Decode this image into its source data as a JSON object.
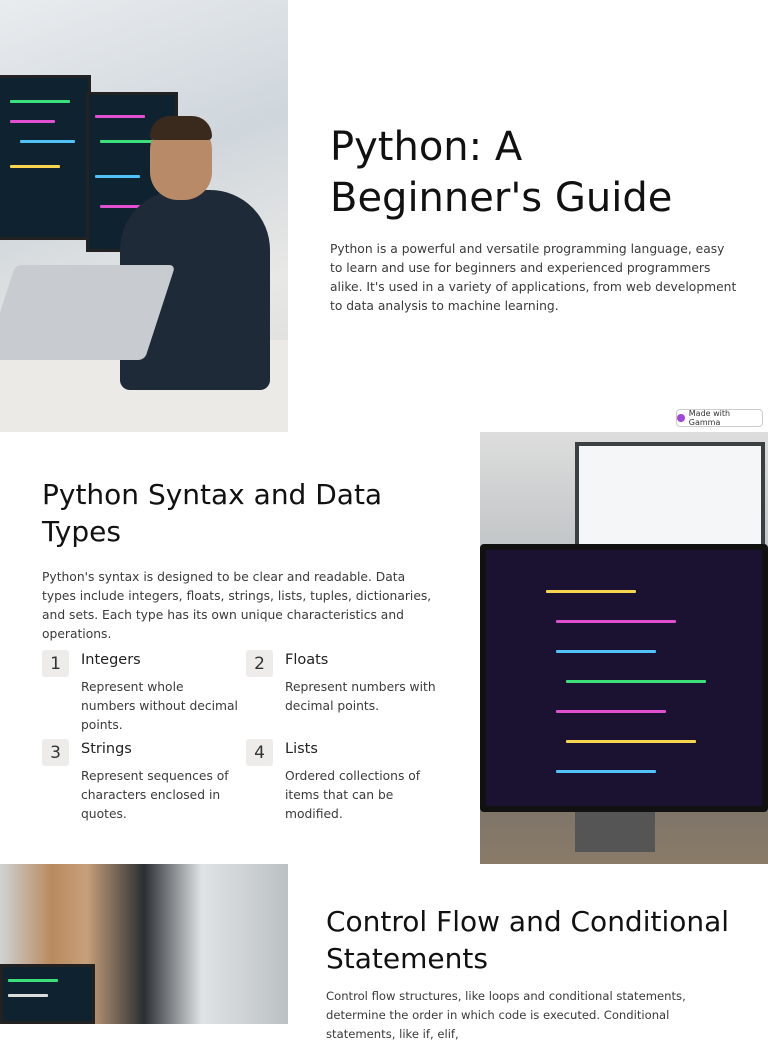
{
  "hero": {
    "title": "Python: A Beginner's Guide",
    "body": "Python is a powerful and versatile programming language, easy to learn and use for beginners and experienced programmers alike. It's used in a variety of applications, from web development to data analysis to machine learning."
  },
  "badge": {
    "label": "Made with Gamma"
  },
  "syntax": {
    "title": "Python Syntax and Data Types",
    "body": "Python's syntax is designed to be clear and readable. Data types include integers, floats, strings, lists, tuples, dictionaries, and sets. Each type has its own unique characteristics and operations.",
    "items": [
      {
        "num": "1",
        "title": "Integers",
        "body": "Represent whole numbers without decimal points."
      },
      {
        "num": "2",
        "title": "Floats",
        "body": "Represent numbers with decimal points."
      },
      {
        "num": "3",
        "title": "Strings",
        "body": "Represent sequences of characters enclosed in quotes."
      },
      {
        "num": "4",
        "title": "Lists",
        "body": "Ordered collections of items that can be modified."
      }
    ]
  },
  "control": {
    "title": "Control Flow and Conditional Statements",
    "body": "Control flow structures, like loops and conditional statements, determine the order in which code is executed. Conditional statements, like if, elif,"
  }
}
